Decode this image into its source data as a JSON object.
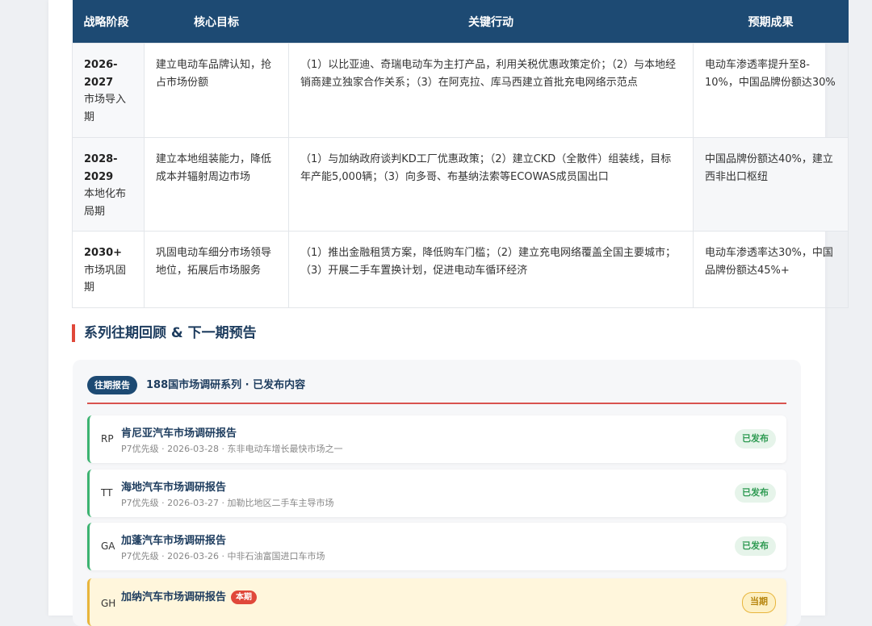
{
  "table": {
    "headers": [
      "战略阶段",
      "核心目标",
      "关键行动",
      "预期成果"
    ],
    "rows": [
      {
        "phase_year": "2026-2027",
        "phase_name": "市场导入期",
        "goal": "建立电动车品牌认知，抢占市场份额",
        "actions": "（1）以比亚迪、奇瑞电动车为主打产品，利用关税优惠政策定价；（2）与本地经销商建立独家合作关系；（3）在阿克拉、库马西建立首批充电网络示范点",
        "result": "电动车渗透率提升至8-10%，中国品牌份额达30%"
      },
      {
        "phase_year": "2028-2029",
        "phase_name": "本地化布局期",
        "goal": "建立本地组装能力，降低成本并辐射周边市场",
        "actions": "（1）与加纳政府谈判KD工厂优惠政策；（2）建立CKD（全散件）组装线，目标年产能5,000辆；（3）向多哥、布基纳法索等ECOWAS成员国出口",
        "result": "中国品牌份额达40%，建立西非出口枢纽"
      },
      {
        "phase_year": "2030+",
        "phase_name": "市场巩固期",
        "goal": "巩固电动车细分市场领导地位，拓展后市场服务",
        "actions": "（1）推出金融租赁方案，降低购车门槛；（2）建立充电网络覆盖全国主要城市；（3）开展二手车置换计划，促进电动车循环经济",
        "result": "电动车渗透率达30%，中国品牌份额达45%+"
      }
    ]
  },
  "section": {
    "title": "系列往期回顾 & 下一期预告"
  },
  "series": {
    "badge": "往期报告",
    "title": "188国市场调研系列 · 已发布内容",
    "reports": [
      {
        "code": "RP",
        "name": "肯尼亚汽车市场调研报告",
        "meta": "P7优先级 · 2026-03-28 · 东非电动车增长最快市场之一",
        "status": "已发布"
      },
      {
        "code": "TT",
        "name": "海地汽车市场调研报告",
        "meta": "P7优先级 · 2026-03-27 · 加勒比地区二手车主导市场",
        "status": "已发布"
      },
      {
        "code": "GA",
        "name": "加蓬汽车市场调研报告",
        "meta": "P7优先级 · 2026-03-26 · 中非石油富国进口车市场",
        "status": "已发布"
      },
      {
        "code": "GH",
        "name": "加纳汽车市场调研报告",
        "tag": "本期",
        "meta": "",
        "status": "当期"
      }
    ]
  },
  "colors": {
    "header_bg": "#1d4a73",
    "accent_red": "#e0483a",
    "published_green": "#3cb371",
    "current_gold": "#e8b53c"
  }
}
